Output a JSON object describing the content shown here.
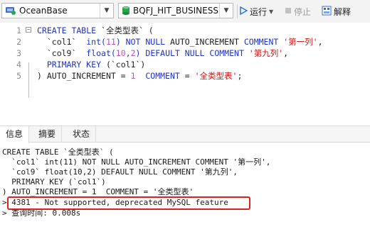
{
  "toolbar": {
    "connection": "OceanBase",
    "database": "BQFJ_HIT_BUSINESS",
    "run_label": "运行",
    "stop_label": "停止",
    "explain_label": "解释"
  },
  "editor": {
    "line_numbers": [
      "1",
      "2",
      "3",
      "4",
      "5"
    ],
    "lines": [
      {
        "parts": [
          {
            "t": "CREATE TABLE ",
            "c": "kw"
          },
          {
            "t": "`全类型表`",
            "c": "id"
          },
          {
            "t": " (",
            "c": "id"
          }
        ]
      },
      {
        "parts": [
          {
            "t": "  `col1`  ",
            "c": "id"
          },
          {
            "t": "int(",
            "c": "kw"
          },
          {
            "t": "11",
            "c": "num"
          },
          {
            "t": ") ",
            "c": "kw"
          },
          {
            "t": "NOT NULL ",
            "c": "kw"
          },
          {
            "t": "AUTO_INCREMENT ",
            "c": "id"
          },
          {
            "t": "COMMENT ",
            "c": "kw"
          },
          {
            "t": "'第一列'",
            "c": "str"
          },
          {
            "t": ",",
            "c": "id"
          }
        ]
      },
      {
        "parts": [
          {
            "t": "  `col9`  ",
            "c": "id"
          },
          {
            "t": "float(",
            "c": "kw"
          },
          {
            "t": "10",
            "c": "num"
          },
          {
            "t": ",",
            "c": "kw"
          },
          {
            "t": "2",
            "c": "num"
          },
          {
            "t": ") ",
            "c": "kw"
          },
          {
            "t": "DEFAULT NULL COMMENT ",
            "c": "kw"
          },
          {
            "t": "'第九列'",
            "c": "str"
          },
          {
            "t": ",",
            "c": "id"
          }
        ]
      },
      {
        "parts": [
          {
            "t": "  PRIMARY KEY ",
            "c": "kw"
          },
          {
            "t": "(`col1`)",
            "c": "id"
          }
        ]
      },
      {
        "parts": [
          {
            "t": ") ",
            "c": "id"
          },
          {
            "t": "AUTO_INCREMENT = ",
            "c": "id"
          },
          {
            "t": "1",
            "c": "num"
          },
          {
            "t": "  ",
            "c": "id"
          },
          {
            "t": "COMMENT ",
            "c": "kw"
          },
          {
            "t": "= ",
            "c": "id"
          },
          {
            "t": "'全类型表'",
            "c": "str"
          },
          {
            "t": ";",
            "c": "id"
          }
        ]
      }
    ]
  },
  "tabs": [
    {
      "label": "信息",
      "active": true
    },
    {
      "label": "摘要",
      "active": false
    },
    {
      "label": "状态",
      "active": false
    }
  ],
  "output": {
    "lines": [
      "CREATE TABLE `全类型表` (",
      "  `col1` int(11) NOT NULL AUTO_INCREMENT COMMENT '第一列',",
      "  `col9` float(10,2) DEFAULT NULL COMMENT '第九列',",
      "  PRIMARY KEY (`col1`)",
      ") AUTO_INCREMENT = 1  COMMENT = '全类型表'",
      "> 4381 - Not supported, deprecated MySQL feature",
      "> 查询时间: 0.008s"
    ]
  },
  "colors": {
    "keyword": "#1e33c8",
    "string": "#d01515",
    "number": "#c04ec0",
    "highlight_border": "#e02020",
    "run_green": "#2aa34a"
  }
}
